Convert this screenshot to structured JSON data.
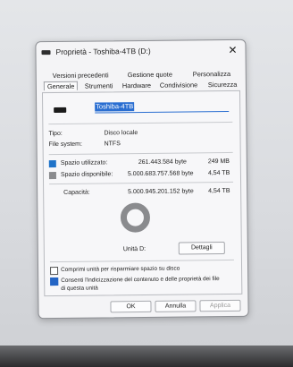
{
  "window": {
    "title": "Proprietà - Toshiba-4TB (D:)",
    "close_glyph": "✕"
  },
  "tabs_row1": [
    "Versioni precedenti",
    "Gestione quote",
    "Personalizza"
  ],
  "tabs_row2": [
    "Generale",
    "Strumenti",
    "Hardware",
    "Condivisione",
    "Sicurezza"
  ],
  "general": {
    "volume_name": "Toshiba-4TB",
    "type_label": "Tipo:",
    "type_value": "Disco locale",
    "fs_label": "File system:",
    "fs_value": "NTFS",
    "used_label": "Spazio utilizzato:",
    "used_bytes": "261.443.584 byte",
    "used_size": "249 MB",
    "free_label": "Spazio disponibile:",
    "free_bytes": "5.000.683.757.568 byte",
    "free_size": "4,54 TB",
    "cap_label": "Capacità:",
    "cap_bytes": "5.000.945.201.152 byte",
    "cap_size": "4,54 TB",
    "drive_label": "Unità D:",
    "details_button": "Dettagli",
    "compress_label": "Comprimi unità per risparmiare spazio su disco",
    "index_label_1": "Consenti l'indicizzazione del contenuto e delle proprietà dei file",
    "index_label_2": "di questa unità",
    "used_fraction": 5e-05
  },
  "buttons": {
    "ok": "OK",
    "cancel": "Annulla",
    "apply": "Applica"
  },
  "colors": {
    "used": "#1f73c9",
    "free": "#8a8b8e",
    "accent": "#2465c5"
  }
}
